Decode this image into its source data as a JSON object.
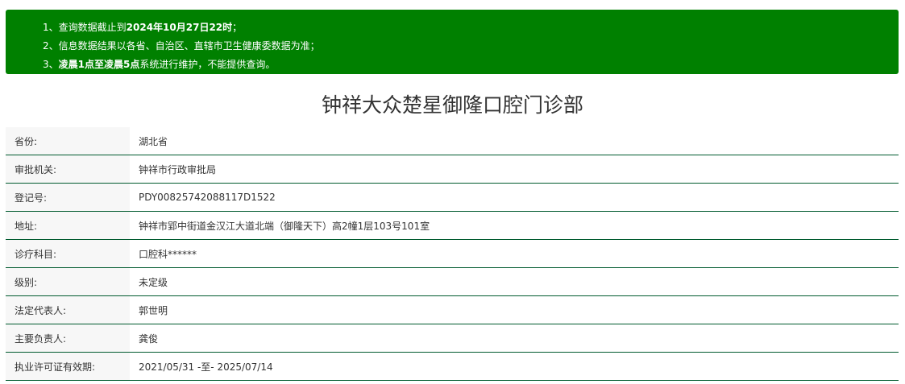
{
  "notice": {
    "items": [
      {
        "prefix": "1、查询数据截止到",
        "bold": "2024年10月27日22时",
        "suffix": "；"
      },
      {
        "prefix": "2、信息数据结果以各省、自治区、直辖市卫生健康委数据为准；",
        "bold": "",
        "suffix": ""
      },
      {
        "prefix": "3、",
        "bold": "凌晨1点至凌晨5点",
        "suffix": "系统进行维护，不能提供查询。"
      }
    ],
    "background_color": "#008000"
  },
  "page_title": "钟祥大众楚星御隆口腔门诊部",
  "details": {
    "rows": [
      {
        "label": "省份:",
        "value": "湖北省"
      },
      {
        "label": "审批机关:",
        "value": "钟祥市行政审批局"
      },
      {
        "label": "登记号:",
        "value": "PDY00825742088117D1522"
      },
      {
        "label": "地址:",
        "value": "钟祥市郢中街道金汉江大道北端（御隆天下）高2幢1层103号101室"
      },
      {
        "label": "诊疗科目:",
        "value": "口腔科******"
      },
      {
        "label": "级别:",
        "value": "未定级"
      },
      {
        "label": "法定代表人:",
        "value": "郭世明"
      },
      {
        "label": "主要负责人:",
        "value": "龚俊"
      },
      {
        "label": "执业许可证有效期:",
        "value": "2021/05/31 -至- 2025/07/14"
      }
    ],
    "border_color": "#005a2e"
  }
}
